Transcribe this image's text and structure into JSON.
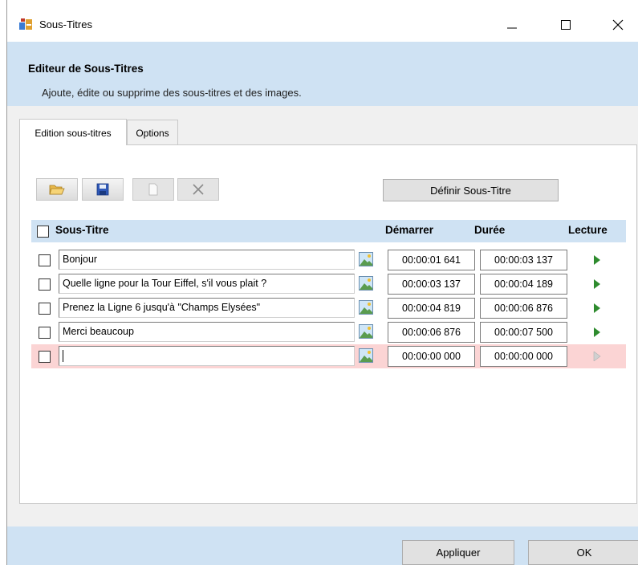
{
  "window": {
    "title": "Sous-Titres"
  },
  "header": {
    "title": "Editeur de Sous-Titres",
    "subtitle": "Ajoute, édite ou supprime des sous-titres et des images."
  },
  "tabs": [
    {
      "label": "Edition sous-titres"
    },
    {
      "label": "Options"
    }
  ],
  "toolbar": {
    "define_label": "Définir Sous-Titre"
  },
  "columns": {
    "subtitle": "Sous-Titre",
    "start": "Démarrer",
    "duration": "Durée",
    "play": "Lecture"
  },
  "rows": [
    {
      "text": "Bonjour",
      "start": "00:00:01 641",
      "duration": "00:00:03 137"
    },
    {
      "text": "Quelle ligne pour la Tour Eiffel, s'il vous plait ?",
      "start": "00:00:03 137",
      "duration": "00:00:04 189"
    },
    {
      "text": "Prenez la Ligne 6 jusqu'à \"Champs Elysées\"",
      "start": "00:00:04 819",
      "duration": "00:00:06 876"
    },
    {
      "text": "Merci beaucoup",
      "start": "00:00:06 876",
      "duration": "00:00:07 500"
    },
    {
      "text": "",
      "start": "00:00:00 000",
      "duration": "00:00:00 000"
    }
  ],
  "footer": {
    "apply_label": "Appliquer",
    "ok_label": "OK"
  },
  "colors": {
    "header_bg": "#cfe2f3",
    "highlight_row": "#fbd4d4",
    "play_active": "#2e8b2e",
    "play_inactive": "#bdbdbd"
  }
}
